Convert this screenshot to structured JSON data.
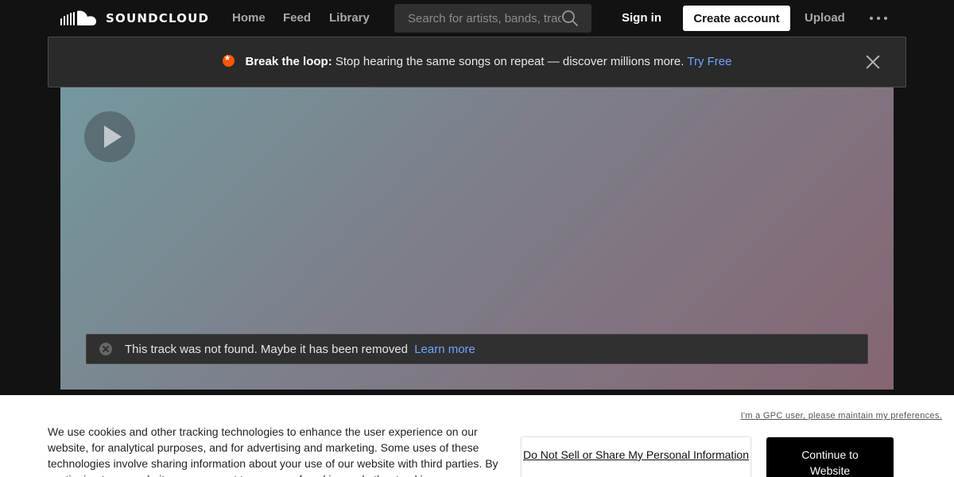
{
  "header": {
    "logo_text": "SOUNDCLOUD",
    "logo_icon": "soundcloud-cloud-icon",
    "nav": [
      "Home",
      "Feed",
      "Library"
    ],
    "search_placeholder": "Search for artists, bands, tracks, podcasts",
    "search_icon": "search-icon",
    "sign_in": "Sign in",
    "create_account": "Create account",
    "upload": "Upload",
    "more_icon": "more-dots-icon"
  },
  "banner": {
    "icon": "star-badge-icon",
    "bold": "Break the loop:",
    "text": "Stop hearing the same songs on repeat — discover millions more.",
    "link": "Try Free",
    "close_icon": "close-icon"
  },
  "player": {
    "play_icon": "play-icon",
    "error_icon": "error-circle-icon",
    "error_text": "This track was not found. Maybe it has been removed",
    "learn_more": "Learn more"
  },
  "cookie": {
    "gpc_link": "I'm a GPC user, please maintain my preferences.",
    "text": "We use cookies and other tracking technologies to enhance the user experience on our website, for analytical purposes, and for advertising and marketing. Some uses of these technologies involve sharing information about your use of our website with third parties. By continuing to our website, you consent to our use of cookies and other tracking",
    "do_not_sell": "Do Not Sell or Share My Personal Information",
    "continue": "Continue to Website"
  },
  "colors": {
    "brand_orange": "#ff5500",
    "link_blue": "#6fa4ff",
    "header_bg": "#121212"
  }
}
